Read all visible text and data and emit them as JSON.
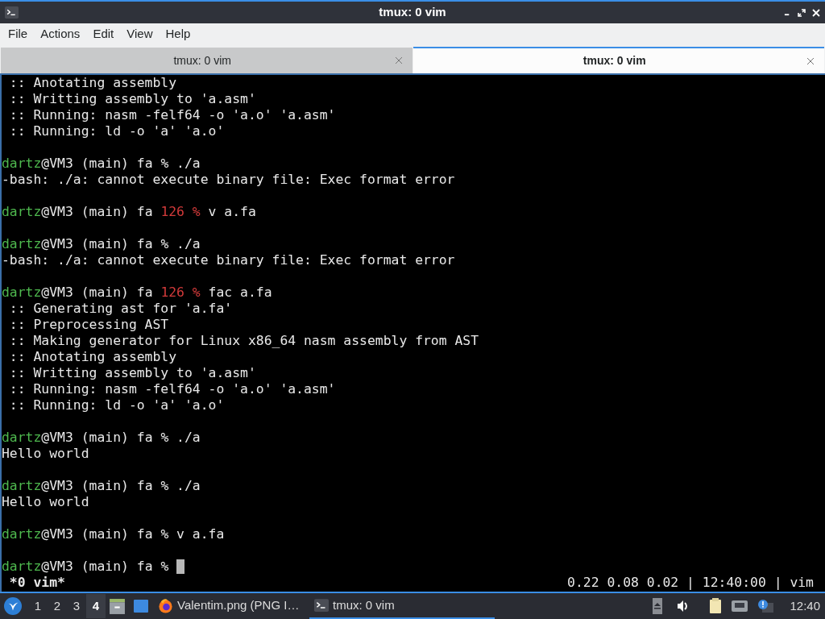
{
  "window": {
    "title": "tmux: 0 vim"
  },
  "menu": [
    "File",
    "Actions",
    "Edit",
    "View",
    "Help"
  ],
  "tabs": [
    {
      "label": "tmux: 0 vim",
      "selected": false
    },
    {
      "label": "tmux: 0 vim",
      "selected": true
    }
  ],
  "terminal": {
    "lines": [
      {
        "kind": "output",
        "text": " :: Anotating assembly"
      },
      {
        "kind": "output",
        "text": " :: Writting assembly to 'a.asm'"
      },
      {
        "kind": "output",
        "text": " :: Running: nasm -felf64 -o 'a.o' 'a.asm'"
      },
      {
        "kind": "output",
        "text": " :: Running: ld -o 'a' 'a.o'"
      },
      {
        "kind": "blank"
      },
      {
        "kind": "prompt",
        "user": "dartz",
        "host": "@VM3 (main) fa",
        "symbol": "%",
        "command": "./a"
      },
      {
        "kind": "output",
        "text": "-bash: ./a: cannot execute binary file: Exec format error"
      },
      {
        "kind": "blank"
      },
      {
        "kind": "prompt",
        "user": "dartz",
        "host": "@VM3 (main) fa",
        "status": "126",
        "symbol": "%",
        "command": "v a.fa"
      },
      {
        "kind": "blank"
      },
      {
        "kind": "prompt",
        "user": "dartz",
        "host": "@VM3 (main) fa",
        "symbol": "%",
        "command": "./a"
      },
      {
        "kind": "output",
        "text": "-bash: ./a: cannot execute binary file: Exec format error"
      },
      {
        "kind": "blank"
      },
      {
        "kind": "prompt",
        "user": "dartz",
        "host": "@VM3 (main) fa",
        "status": "126",
        "symbol": "%",
        "command": "fac a.fa"
      },
      {
        "kind": "output",
        "text": " :: Generating ast for 'a.fa'"
      },
      {
        "kind": "output",
        "text": " :: Preprocessing AST"
      },
      {
        "kind": "output",
        "text": " :: Making generator for Linux x86_64 nasm assembly from AST"
      },
      {
        "kind": "output",
        "text": " :: Anotating assembly"
      },
      {
        "kind": "output",
        "text": " :: Writting assembly to 'a.asm'"
      },
      {
        "kind": "output",
        "text": " :: Running: nasm -felf64 -o 'a.o' 'a.asm'"
      },
      {
        "kind": "output",
        "text": " :: Running: ld -o 'a' 'a.o'"
      },
      {
        "kind": "blank"
      },
      {
        "kind": "prompt",
        "user": "dartz",
        "host": "@VM3 (main) fa",
        "symbol": "%",
        "command": "./a"
      },
      {
        "kind": "output",
        "text": "Hello world"
      },
      {
        "kind": "blank"
      },
      {
        "kind": "prompt",
        "user": "dartz",
        "host": "@VM3 (main) fa",
        "symbol": "%",
        "command": "./a"
      },
      {
        "kind": "output",
        "text": "Hello world"
      },
      {
        "kind": "blank"
      },
      {
        "kind": "prompt",
        "user": "dartz",
        "host": "@VM3 (main) fa",
        "symbol": "%",
        "command": "v a.fa"
      },
      {
        "kind": "blank"
      },
      {
        "kind": "prompt",
        "user": "dartz",
        "host": "@VM3 (main) fa",
        "symbol": "%",
        "cursor": true
      }
    ],
    "status_left": " *0 vim*",
    "status_right": "0.22 0.08 0.02 | 12:40:00 | vim"
  },
  "taskbar": {
    "workspaces": [
      {
        "label": "1",
        "selected": false
      },
      {
        "label": "2",
        "selected": false
      },
      {
        "label": "3",
        "selected": false
      },
      {
        "label": "4",
        "selected": true
      }
    ],
    "tasks": [
      {
        "kind": "browser",
        "label": "Valentim.png (PNG I…",
        "selected": false
      },
      {
        "kind": "terminal",
        "label": "tmux: 0 vim",
        "selected": true
      }
    ],
    "clock": "12:40"
  }
}
